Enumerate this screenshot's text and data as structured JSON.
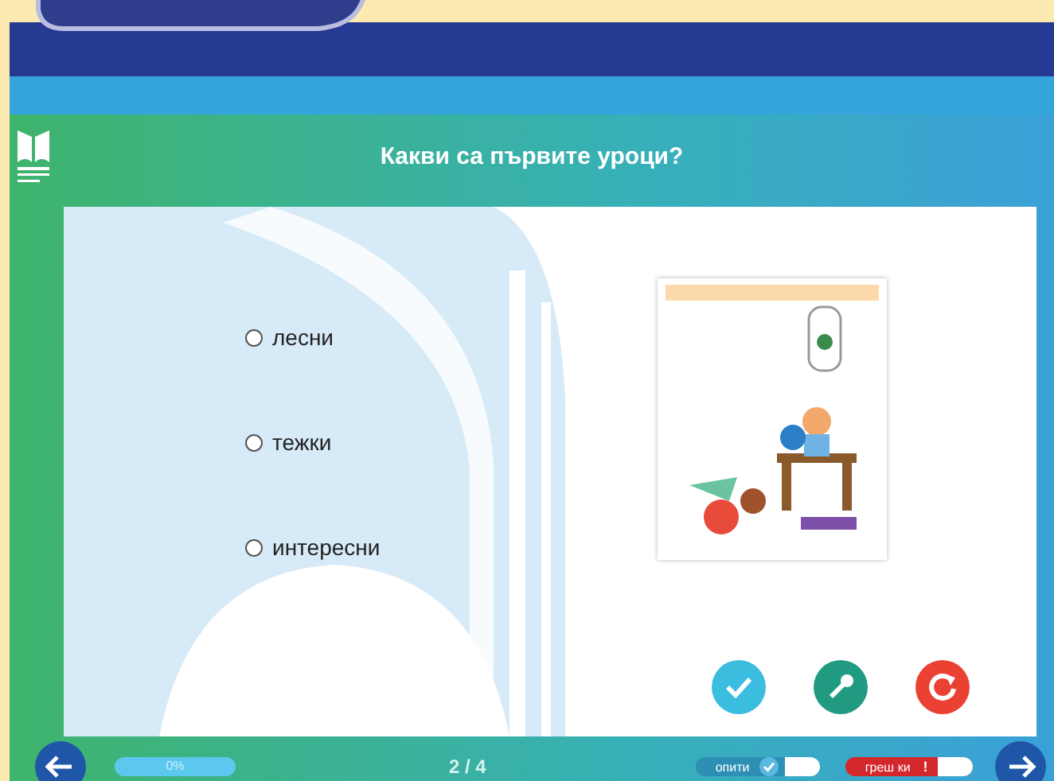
{
  "question": {
    "title": "Какви са първите уроци?"
  },
  "options": [
    {
      "label": "лесни",
      "selected": false
    },
    {
      "label": "тежки",
      "selected": false
    },
    {
      "label": "интересни",
      "selected": false
    }
  ],
  "footer": {
    "progress": {
      "label": "0%",
      "level": 0
    },
    "page": "2 / 4",
    "attempts": {
      "label": "опити",
      "on": true
    },
    "errors": {
      "label": "греш ки",
      "mark": "!"
    }
  }
}
